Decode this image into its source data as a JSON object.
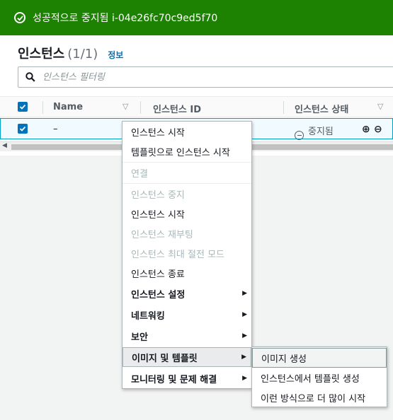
{
  "banner": {
    "message": "성공적으로 중지됨 i-04e26fc70c9ed5f70",
    "color": "#1d8102"
  },
  "header": {
    "title": "인스턴스",
    "count": "(1/1)",
    "info_link": "정보"
  },
  "filter": {
    "placeholder": "인스턴스 필터링",
    "icon": "search-icon"
  },
  "table": {
    "columns": [
      "Name",
      "인스턴스 ID",
      "인스턴스 상태"
    ],
    "rows": [
      {
        "name": "–",
        "instance_id": "",
        "state": "중지됨"
      }
    ]
  },
  "context_menu": {
    "items": [
      {
        "label": "인스턴스 시작",
        "enabled": true
      },
      {
        "label": "템플릿으로 인스턴스 시작",
        "enabled": true
      },
      {
        "label": "연결",
        "enabled": false
      },
      {
        "label": "인스턴스 중지",
        "enabled": false
      },
      {
        "label": "인스턴스 시작",
        "enabled": true
      },
      {
        "label": "인스턴스 재부팅",
        "enabled": false
      },
      {
        "label": "인스턴스 최대 절전 모드",
        "enabled": false
      },
      {
        "label": "인스턴스 종료",
        "enabled": true
      },
      {
        "label": "인스턴스 설정",
        "submenu": true
      },
      {
        "label": "네트워킹",
        "submenu": true
      },
      {
        "label": "보안",
        "submenu": true
      },
      {
        "label": "이미지 및 템플릿",
        "submenu": true,
        "active": true
      },
      {
        "label": "모니터링 및 문제 해결",
        "submenu": true
      }
    ]
  },
  "submenu": {
    "items": [
      {
        "label": "이미지 생성",
        "active": true
      },
      {
        "label": "인스턴스에서 템플릿 생성"
      },
      {
        "label": "이런 방식으로 더 많이 시작"
      }
    ]
  }
}
